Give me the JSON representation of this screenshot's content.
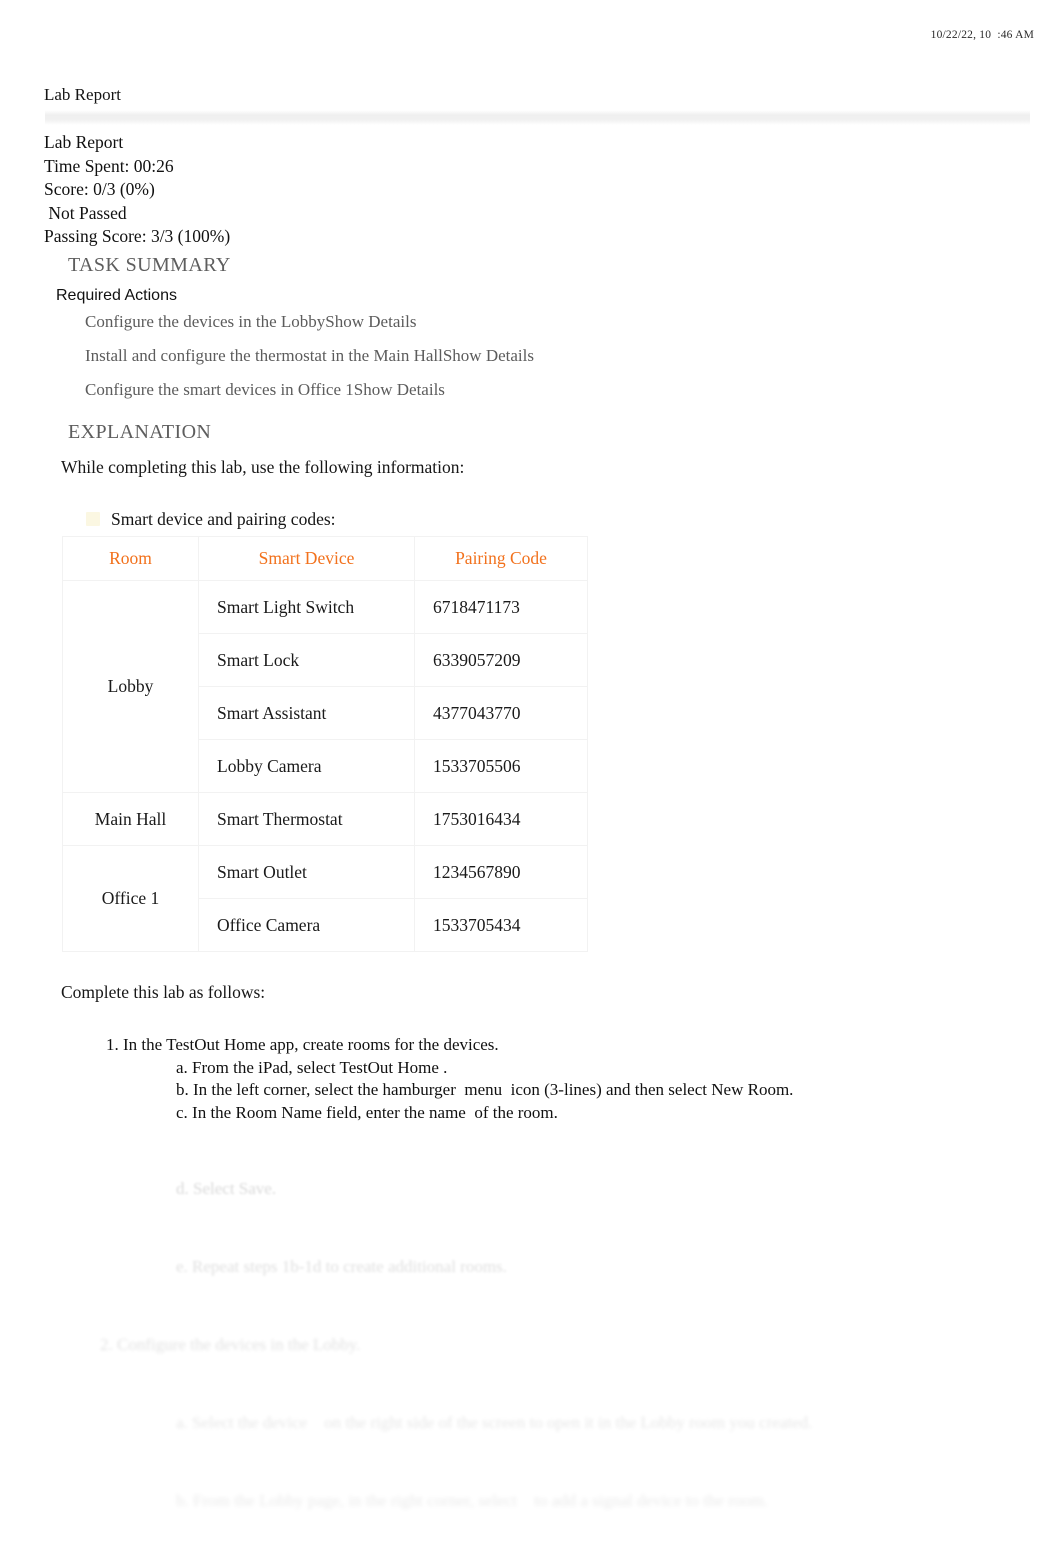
{
  "print_header": {
    "timestamp": "10/22/22, 10  :46 AM"
  },
  "document": {
    "title": "Lab Report"
  },
  "summary": {
    "heading": "Lab Report",
    "time_spent": "Time Spent: 00:26",
    "score": "Score: 0/3 (0%)",
    "result": " Not Passed",
    "passing_score": "Passing Score: 3/3 (100%)"
  },
  "task_summary": {
    "heading": "TASK SUMMARY",
    "required_actions_label": "Required Actions",
    "actions": [
      "Configure the devices in the LobbyShow Details",
      "Install and configure the thermostat in the Main HallShow Details",
      "Configure the smart devices in Office 1Show Details"
    ]
  },
  "explanation": {
    "heading": "EXPLANATION",
    "intro": "While completing this lab, use the following information:",
    "bullet": "Smart device and pairing codes:",
    "complete_line": "Complete this lab as follows:"
  },
  "device_table": {
    "columns": [
      "Room",
      "Smart Device",
      "Pairing Code"
    ],
    "rows": [
      {
        "room": "Lobby",
        "room_span": 4,
        "device": "Smart Light Switch",
        "code": "6718471173"
      },
      {
        "room": "",
        "room_span": 0,
        "device": "Smart Lock",
        "code": "6339057209"
      },
      {
        "room": "",
        "room_span": 0,
        "device": "Smart Assistant",
        "code": "4377043770"
      },
      {
        "room": "",
        "room_span": 0,
        "device": "Lobby Camera",
        "code": "1533705506"
      },
      {
        "room": "Main Hall",
        "room_span": 1,
        "device": "Smart Thermostat",
        "code": "1753016434"
      },
      {
        "room": "Office 1",
        "room_span": 2,
        "device": "Smart Outlet",
        "code": "1234567890"
      },
      {
        "room": "",
        "room_span": 0,
        "device": "Office Camera",
        "code": "1533705434"
      }
    ]
  },
  "steps": [
    "1. In the TestOut Home app, create rooms for the devices.",
    "a. From the iPad, select TestOut Home .",
    "b. In the left corner, select the hamburger  menu  icon (3-lines) and then select New Room.",
    "c. In the Room Name field, enter the name  of the room."
  ],
  "faded_steps": [
    "d. Select Save.",
    "e. Repeat steps 1b-1d to create additional rooms.",
    "2. Configure the devices in the Lobby.",
    "a. Select the device    on the right side of the screen to open it in the Lobby room you created.",
    "b. From the Lobby page, in the right corner, select    to add a signal device to the room."
  ],
  "colors": {
    "table_header": "#f2711c",
    "section_heading": "#5e5e5e",
    "body_text": "#111111",
    "muted_text": "#5c5c5c",
    "bullet_marker": "#fbf7e2",
    "table_border": "#f2f2f2"
  }
}
